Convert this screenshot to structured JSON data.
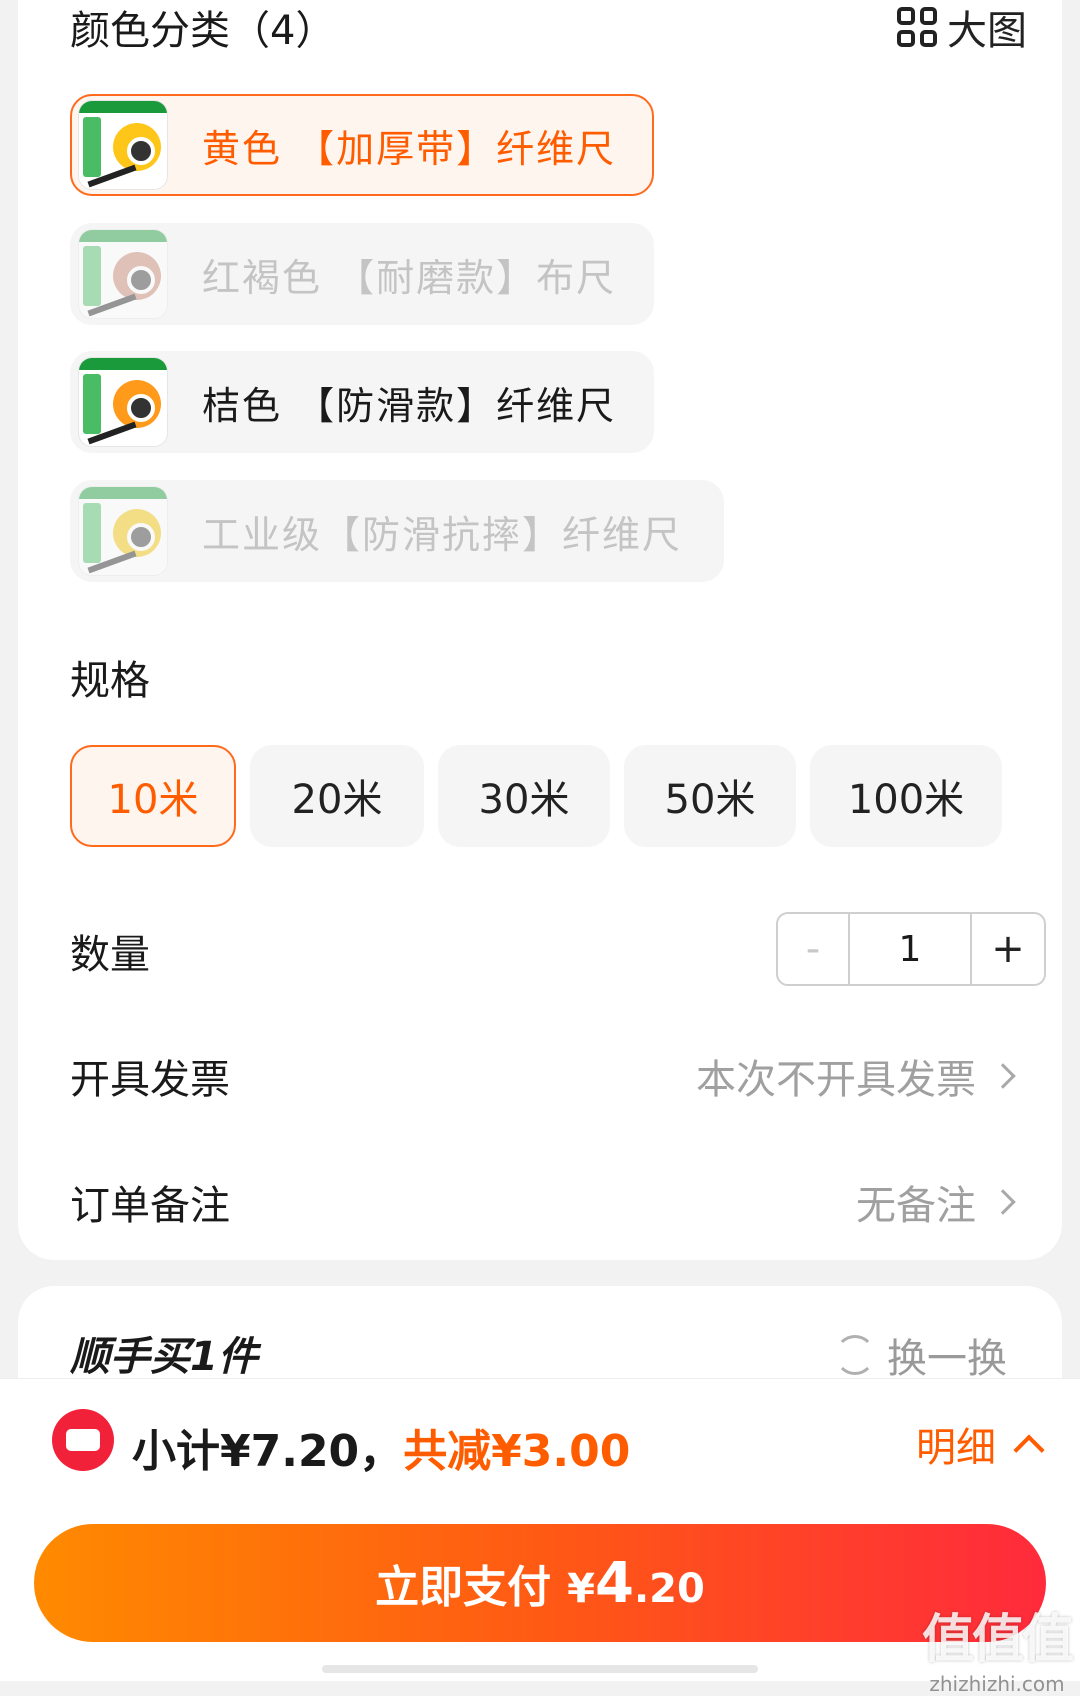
{
  "color_section": {
    "title": "颜色分类（4）",
    "big_view_label": "大图",
    "options": [
      {
        "label": "黄色 【加厚带】纤维尺",
        "state": "selected",
        "reel_color": "#ffc61a"
      },
      {
        "label": "红褐色 【耐磨款】布尺",
        "state": "disabled",
        "reel_color": "#c7836f"
      },
      {
        "label": "桔色 【防滑款】纤维尺",
        "state": "normal",
        "reel_color": "#ff9a1a"
      },
      {
        "label": "工业级【防滑抗摔】纤维尺",
        "state": "disabled",
        "reel_color": "#f2c400"
      }
    ]
  },
  "spec_section": {
    "title": "规格",
    "options": [
      "10米",
      "20米",
      "30米",
      "50米",
      "100米"
    ],
    "selected_index": 0
  },
  "quantity": {
    "label": "数量",
    "minus": "-",
    "value": "1",
    "plus": "+"
  },
  "invoice": {
    "label": "开具发票",
    "value": "本次不开具发票"
  },
  "remark": {
    "label": "订单备注",
    "value": "无备注"
  },
  "extra": {
    "title": "顺手买1件",
    "swap_label": "换一换"
  },
  "summary": {
    "subtotal": "小计¥7.20，",
    "saving": "共减¥3.00",
    "detail_label": "明细"
  },
  "pay_button": {
    "label": "立即支付",
    "currency": "¥",
    "amount_int": "4",
    "amount_dec": ".20"
  },
  "watermark": {
    "big": "值值值",
    "small": "zhizhizhi.com"
  },
  "colors": {
    "accent": "#ff5c00",
    "selected_bg": "#fff5ef",
    "coupon": "#f2213a"
  }
}
